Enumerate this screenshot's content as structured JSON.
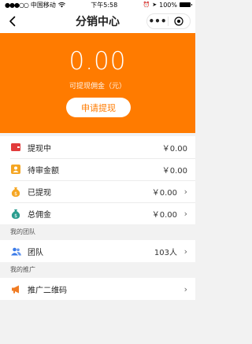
{
  "status": {
    "carrier": "中国移动",
    "time": "下午5:58",
    "battery_pct": "100%"
  },
  "nav": {
    "title": "分销中心",
    "menu_dots": "•••"
  },
  "hero": {
    "amount": "0.00",
    "amount_label": "可提现佣金（元）",
    "apply_button": "申请提现"
  },
  "finance": [
    {
      "label": "提现中",
      "value": "￥0.00",
      "icon": "wallet-icon",
      "color": "#e23b3b",
      "chevron": false
    },
    {
      "label": "待审金额",
      "value": "￥0.00",
      "icon": "user-card-icon",
      "color": "#f5a623",
      "chevron": false
    },
    {
      "label": "已提现",
      "value": "￥0.00",
      "icon": "money-bag-icon",
      "color": "#f5a623",
      "chevron": true
    },
    {
      "label": "总佣金",
      "value": "￥0.00",
      "icon": "money-bag-icon",
      "color": "#2a9d8f",
      "chevron": true
    }
  ],
  "team_section": {
    "header": "我的团队",
    "row": {
      "label": "团队",
      "value": "103人",
      "icon": "team-icon",
      "color": "#3b7be8"
    }
  },
  "promo_section": {
    "header": "我的推广",
    "row": {
      "label": "推广二维码",
      "value": "",
      "icon": "megaphone-icon",
      "color": "#f07c24"
    }
  },
  "colors": {
    "accent": "#ff7b00"
  }
}
